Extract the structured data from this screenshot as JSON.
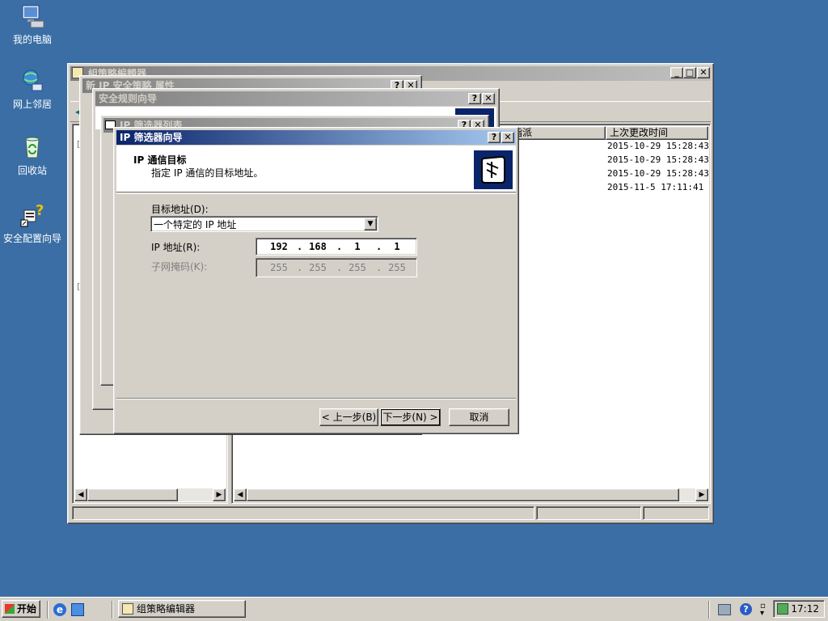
{
  "desktop": {
    "icons": [
      {
        "label": "我的电脑"
      },
      {
        "label": "网上邻居"
      },
      {
        "label": "回收站"
      },
      {
        "label": "安全配置向导"
      }
    ]
  },
  "gpe": {
    "title": "組策略編輯器",
    "columns": {
      "assignment": "已指派",
      "last_modified": "上次更改时间"
    },
    "rows": [
      {
        "time": "2015-10-29 15:28:43"
      },
      {
        "time": "2015-10-29 15:28:43"
      },
      {
        "time": "2015-10-29 15:28:43"
      },
      {
        "time": "2015-11-5 17:11:41"
      }
    ]
  },
  "ipsec_props": {
    "title": "新 IP 安全策略 属性"
  },
  "rule_wizard": {
    "title": "安全规则向导"
  },
  "filter_list": {
    "title": "IP 筛选器列表"
  },
  "filter_wizard": {
    "title": "IP 筛选器向导",
    "heading": "IP 通信目标",
    "subheading": "指定 IP 通信的目标地址。",
    "dest_label": "目标地址(D):",
    "dest_value": "一个特定的 IP 地址",
    "ip_label": "IP 地址(R):",
    "ip": [
      "192",
      "168",
      "1",
      "1"
    ],
    "mask_label": "子网掩码(K):",
    "mask": [
      "255",
      "255",
      "255",
      "255"
    ],
    "back": "< 上一步(B)",
    "next": "下一步(N) >",
    "cancel": "取消"
  },
  "taskbar": {
    "start": "开始",
    "task": "组策略编辑器",
    "clock": "17:12"
  },
  "colors": {
    "desktop": "#3a6ea5",
    "titlebar_active": "#0a246a",
    "face": "#d4d0c8"
  }
}
